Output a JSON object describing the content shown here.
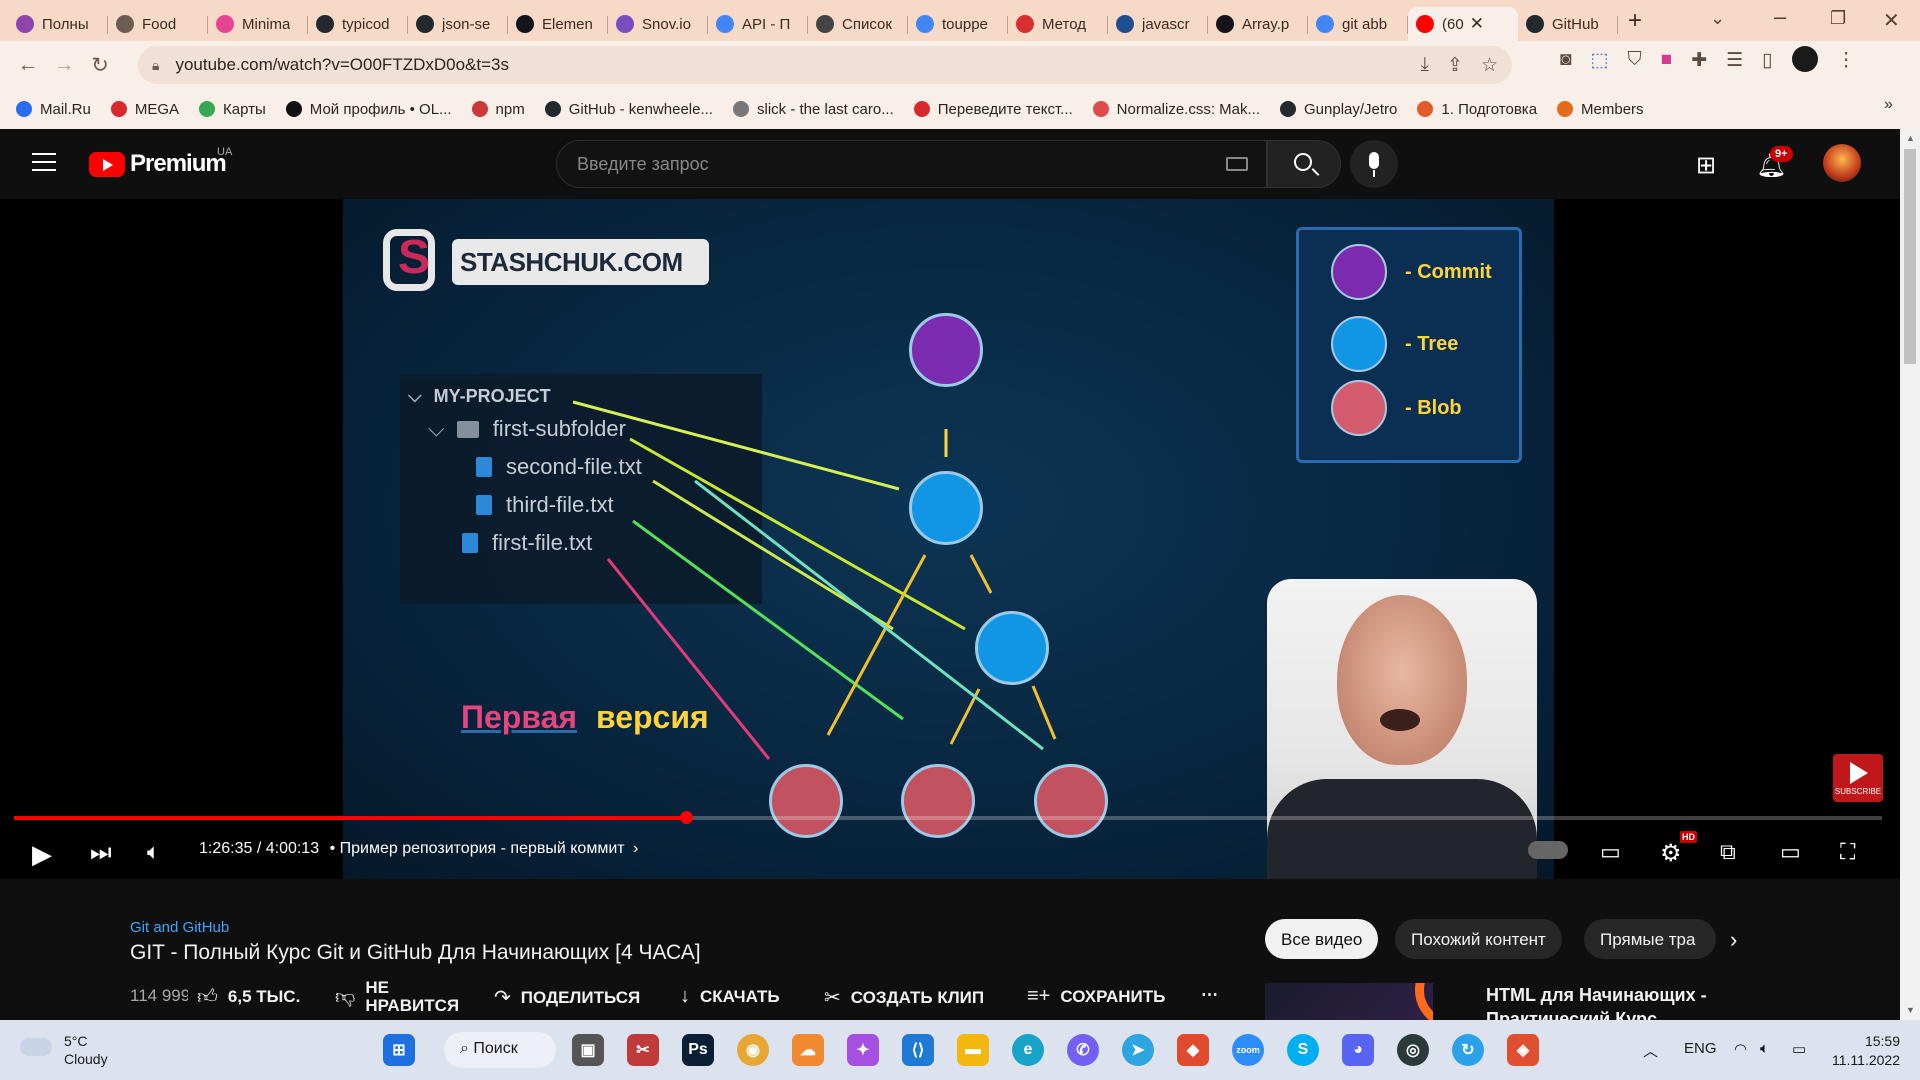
{
  "browser": {
    "tabs": [
      {
        "title": "Полны",
        "icon": "instagram-icon",
        "color": "#8e44ad"
      },
      {
        "title": "Food",
        "icon": "globe-icon",
        "color": "#6d5c53"
      },
      {
        "title": "Minima",
        "icon": "tag-icon",
        "color": "#e84393"
      },
      {
        "title": "typicod",
        "icon": "github-icon",
        "color": "#24292e"
      },
      {
        "title": "json-se",
        "icon": "github-icon",
        "color": "#24292e"
      },
      {
        "title": "Elemen",
        "icon": "mdn-icon",
        "color": "#15141a"
      },
      {
        "title": "Snov.io",
        "icon": "snov-icon",
        "color": "#7b4bc4"
      },
      {
        "title": "API - П",
        "icon": "google-icon",
        "color": "#4285f4"
      },
      {
        "title": "Список",
        "icon": "wikipedia-icon",
        "color": "#444"
      },
      {
        "title": "touppe",
        "icon": "google-icon",
        "color": "#4285f4"
      },
      {
        "title": "Метод",
        "icon": "hexlet-icon",
        "color": "#d63030"
      },
      {
        "title": "javascr",
        "icon": "javascript-icon",
        "color": "#1f4d8f"
      },
      {
        "title": "Array.p",
        "icon": "mdn-icon",
        "color": "#15141a"
      },
      {
        "title": "git abb",
        "icon": "google-icon",
        "color": "#4285f4"
      },
      {
        "title": "(60",
        "icon": "youtube-icon",
        "color": "#ff0000",
        "active": true
      },
      {
        "title": "GitHub",
        "icon": "github-icon",
        "color": "#24292e"
      }
    ],
    "url": "youtube.com/watch?v=O00FTZDxD0o&t=3s",
    "bookmarks": [
      {
        "label": "Mail.Ru",
        "color": "#2a6cf0"
      },
      {
        "label": "MEGA",
        "color": "#d9272e"
      },
      {
        "label": "Карты",
        "color": "#34a853"
      },
      {
        "label": "Мой профиль • OL...",
        "color": "#111"
      },
      {
        "label": "npm",
        "color": "#cb3837"
      },
      {
        "label": "GitHub - kenwheele...",
        "color": "#24292e"
      },
      {
        "label": "slick - the last caro...",
        "color": "#777"
      },
      {
        "label": "Переведите текст...",
        "color": "#d9272e"
      },
      {
        "label": "Normalize.css: Mak...",
        "color": "#e04a4a"
      },
      {
        "label": "Gunplay/Jetro",
        "color": "#24292e"
      },
      {
        "label": "1. Подготовка",
        "color": "#e25b2b"
      },
      {
        "label": "Members",
        "color": "#e36b1a"
      }
    ]
  },
  "youtube": {
    "logo_text": "Premium",
    "region": "UA",
    "search_placeholder": "Введите запрос",
    "notifications_badge": "9+"
  },
  "video": {
    "brand": "STASHCHUK.COM",
    "explorer": {
      "root": "MY-PROJECT",
      "folder": "first-subfolder",
      "files_nested": [
        "second-file.txt",
        "third-file.txt"
      ],
      "file_root": "first-file.txt"
    },
    "caption_word1": "Первая",
    "caption_word2": "версия",
    "legend": [
      {
        "label": "- Commit",
        "color": "#7b2bb0"
      },
      {
        "label": "- Tree",
        "color": "#1196e6"
      },
      {
        "label": "- Blob",
        "color": "#d45b6d"
      }
    ],
    "subscribe_label": "SUBSCRIBE"
  },
  "player": {
    "progress_fraction": 0.36,
    "time": "1:26:35 / 4:00:13",
    "chapter": "• Пример репозитория - первый коммит",
    "hd_badge": "HD"
  },
  "info": {
    "channel": "Git and GitHub",
    "title": "GIT - Полный Курс Git и GitHub Для Начинающих [4 ЧАСА]",
    "views": "114 999",
    "likes": "6,5 ТЫС.",
    "dislike": "НЕ НРАВИТСЯ",
    "share": "ПОДЕЛИТЬСЯ",
    "download": "СКАЧАТЬ",
    "clip": "СОЗДАТЬ КЛИП",
    "save": "СОХРАНИТЬ",
    "chips": [
      "Все видео",
      "Похожий контент",
      "Прямые тра"
    ],
    "reco_title": "HTML для Начинающих - Практический Курс"
  },
  "taskbar": {
    "temperature": "5°C",
    "weather": "Cloudy",
    "search_label": "Поиск",
    "lang": "ENG",
    "time": "15:59",
    "date": "11.11.2022"
  }
}
